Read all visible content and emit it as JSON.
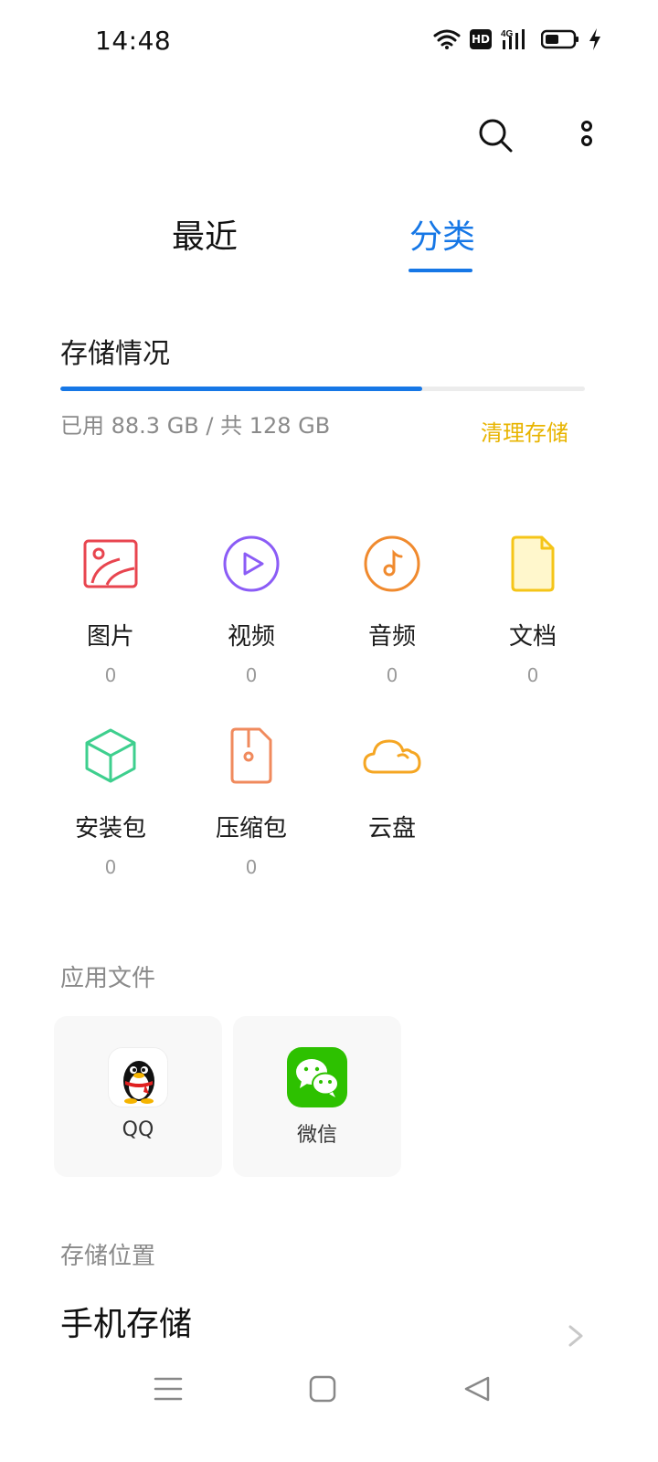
{
  "status_bar": {
    "time": "14:48",
    "hd_badge": "HD",
    "network": "4G",
    "icons": [
      "wifi-icon",
      "hd-icon",
      "signal-4g-icon",
      "battery-icon",
      "charging-icon"
    ]
  },
  "toolbar": {
    "icons": [
      "search-icon",
      "more-vertical-icon"
    ]
  },
  "tabs": [
    {
      "label": "最近",
      "active": false
    },
    {
      "label": "分类",
      "active": true
    }
  ],
  "storage": {
    "title": "存储情况",
    "usage_text": "已用 88.3 GB / 共 128 GB",
    "used_fraction": 0.69,
    "clean_label": "清理存储"
  },
  "categories": [
    {
      "label": "图片",
      "count": "0",
      "icon": "image-icon",
      "color": "#e8454f"
    },
    {
      "label": "视频",
      "count": "0",
      "icon": "play-circle-icon",
      "color": "#8b5cf6"
    },
    {
      "label": "音频",
      "count": "0",
      "icon": "music-note-icon",
      "color": "#f08a2e"
    },
    {
      "label": "文档",
      "count": "0",
      "icon": "document-icon",
      "color": "#f5c518"
    },
    {
      "label": "安装包",
      "count": "0",
      "icon": "package-cube-icon",
      "color": "#3ecf8e"
    },
    {
      "label": "压缩包",
      "count": "0",
      "icon": "zip-file-icon",
      "color": "#f08a5d"
    },
    {
      "label": "云盘",
      "count": "",
      "icon": "cloud-icon",
      "color": "#f5a623"
    }
  ],
  "app_files": {
    "title": "应用文件",
    "apps": [
      {
        "name": "QQ",
        "icon": "qq-penguin-icon"
      },
      {
        "name": "微信",
        "icon": "wechat-icon"
      }
    ]
  },
  "storage_location": {
    "title": "存储位置",
    "item": "手机存储"
  },
  "colors": {
    "accent": "#1677e6",
    "clean": "#e8b400"
  }
}
